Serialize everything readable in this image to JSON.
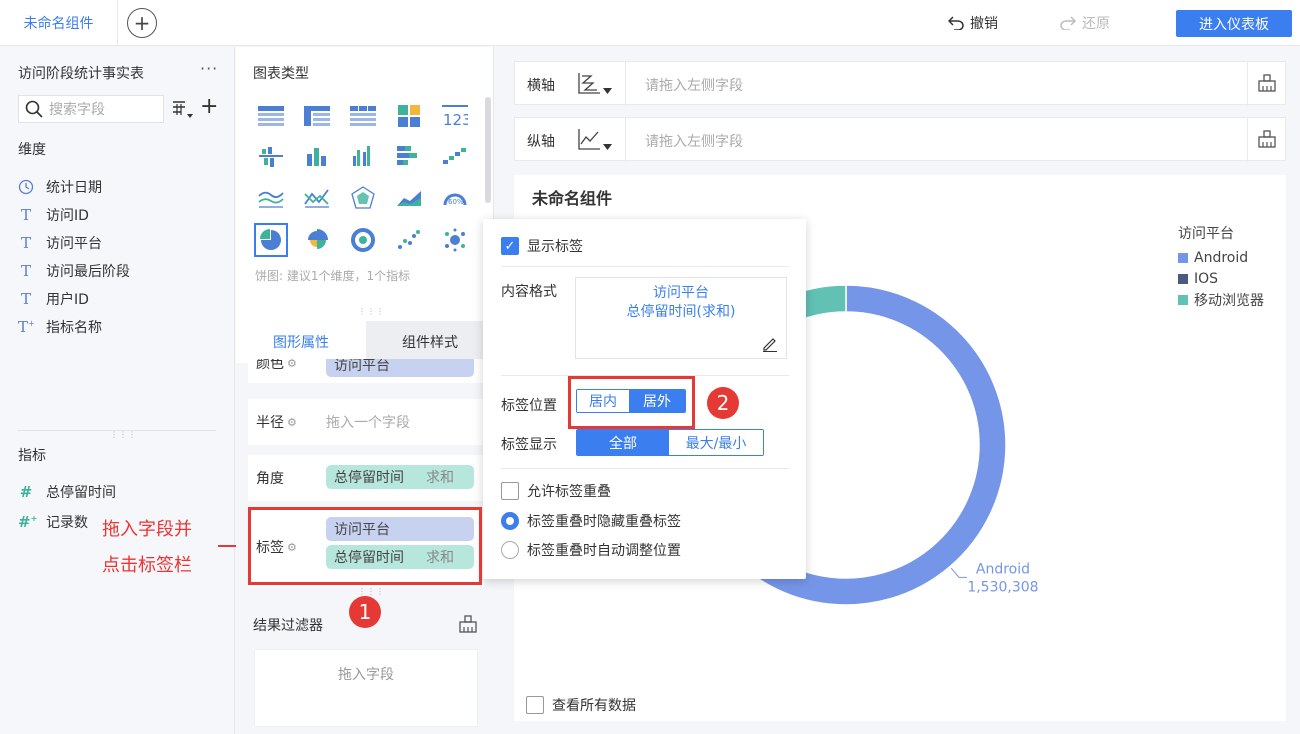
{
  "topbar": {
    "active_tab": "未命名组件",
    "add_tab": "+",
    "undo": "撤销",
    "redo": "还原",
    "enter_dashboard": "进入仪表板"
  },
  "left": {
    "table_name": "访问阶段统计事实表",
    "more": "···",
    "search_placeholder": "搜索字段",
    "dimensions_title": "维度",
    "dimensions": [
      {
        "icon": "clock-icon",
        "label": "统计日期"
      },
      {
        "icon": "text-type-icon",
        "label": "访问ID"
      },
      {
        "icon": "text-type-icon",
        "label": "访问平台"
      },
      {
        "icon": "text-type-icon",
        "label": "访问最后阶段"
      },
      {
        "icon": "text-type-icon",
        "label": "用户ID"
      },
      {
        "icon": "text-calc-type-icon",
        "label": "指标名称"
      }
    ],
    "measures_title": "指标",
    "measures": [
      {
        "icon": "number-type-icon",
        "label": "总停留时间"
      },
      {
        "icon": "number-calc-type-icon",
        "label": "记录数"
      }
    ],
    "annotation_line1": "拖入字段并",
    "annotation_line2": "点击标签栏"
  },
  "mid": {
    "chart_type_title": "图表类型",
    "chart_hint": "饼图: 建议1个维度，1个指标",
    "tab_graph": "图形属性",
    "tab_style": "组件样式",
    "color_label": "颜色",
    "color_value": "访问平台",
    "radius_label": "半径",
    "radius_placeholder": "拖入一个字段",
    "angle_label": "角度",
    "angle_field": "总停留时间",
    "angle_agg": "求和",
    "label_label": "标签",
    "label_field1": "访问平台",
    "label_field2": "总停留时间",
    "label_agg": "求和",
    "filter_title": "结果过滤器",
    "filter_placeholder": "拖入字段"
  },
  "axes": {
    "x_label": "横轴",
    "y_label": "纵轴",
    "placeholder": "请拖入左侧字段"
  },
  "canvas": {
    "title": "未命名组件",
    "show_all": "查看所有数据"
  },
  "chart_data": {
    "type": "pie",
    "categories": [
      "Android",
      "IOS",
      "移动浏览器"
    ],
    "values": [
      1530308,
      322000,
      122000
    ],
    "colors": [
      "#7595e8",
      "#4a5b7f",
      "#61c1b3"
    ],
    "legend_title": "访问平台",
    "data_label_name": "Android",
    "data_label_value": "1,530,308",
    "legend": "top-right"
  },
  "popup": {
    "show_label": "显示标签",
    "content_format_label": "内容格式",
    "content_line1": "访问平台",
    "content_line2": "总停留时间(求和)",
    "position_label": "标签位置",
    "pos_inside": "居内",
    "pos_outside": "居外",
    "display_label": "标签显示",
    "disp_all": "全部",
    "disp_maxmin": "最大/最小",
    "allow_overlap": "允许标签重叠",
    "hide_overlap": "标签重叠时隐藏重叠标签",
    "auto_adjust": "标签重叠时自动调整位置"
  },
  "badges": {
    "one": "1",
    "two": "2"
  },
  "colors": {
    "accent": "#3a7ef0",
    "annotation": "#e53935"
  }
}
